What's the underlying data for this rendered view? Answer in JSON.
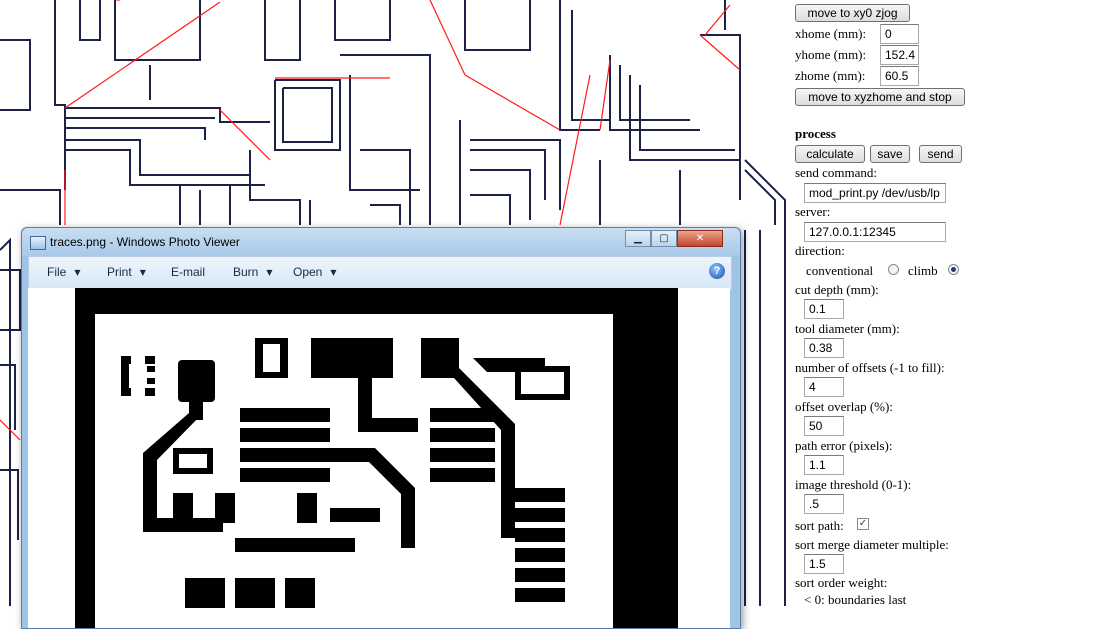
{
  "control_panel": {
    "move_xy0_button": "move to xy0 zjog",
    "xhome_label": "xhome (mm):",
    "xhome_value": "0",
    "yhome_label": "yhome (mm):",
    "yhome_value": "152.4",
    "zhome_label": "zhome (mm):",
    "zhome_value": "60.5",
    "move_home_button": "move to xyzhome and stop",
    "process_heading": "process",
    "calculate_button": "calculate",
    "save_button": "save",
    "send_button": "send",
    "send_command_label": "send command:",
    "send_command_value": "mod_print.py /dev/usb/lp",
    "server_label": "server:",
    "server_value": "127.0.0.1:12345",
    "direction_label": "direction:",
    "direction_options": [
      "conventional",
      "climb"
    ],
    "direction_selected": "climb",
    "cut_depth_label": "cut depth (mm):",
    "cut_depth_value": "0.1",
    "tool_diameter_label": "tool diameter (mm):",
    "tool_diameter_value": "0.38",
    "offsets_label": "number of offsets (-1 to fill):",
    "offsets_value": "4",
    "overlap_label": "offset overlap (%):",
    "overlap_value": "50",
    "path_error_label": "path error (pixels):",
    "path_error_value": "1.1",
    "threshold_label": "image threshold (0-1):",
    "threshold_value": ".5",
    "sort_path_label": "sort path:",
    "sort_path_checked": true,
    "merge_label": "sort merge diameter multiple:",
    "merge_value": "1.5",
    "order_weight_label": "sort order weight:",
    "order_weight_note": "< 0: boundaries last"
  },
  "viewer": {
    "title": "traces.png - Windows Photo Viewer",
    "menu": [
      "File",
      "Print",
      "E-mail",
      "Burn",
      "Open"
    ],
    "help": "?",
    "min_glyph": "▁",
    "max_glyph": "▢",
    "close_glyph": "✕"
  },
  "colors": {
    "toolpath": "#1c2147",
    "jump_path": "#ff1a1a",
    "titlebar": "#a9c9e8",
    "trace_black": "#000000"
  }
}
